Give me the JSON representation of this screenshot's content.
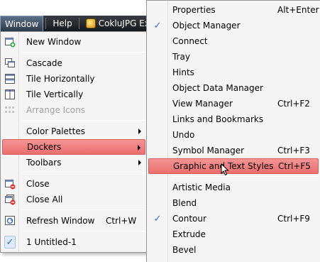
{
  "menubar": {
    "window_label": "Window",
    "help_label": "Help",
    "app_title": "CokluJPG Expo"
  },
  "window_menu": {
    "new_window": "New Window",
    "cascade": "Cascade",
    "tile_horizontally": "Tile Horizontally",
    "tile_vertically": "Tile Vertically",
    "arrange_icons": "Arrange Icons",
    "color_palettes": "Color Palettes",
    "dockers": "Dockers",
    "toolbars": "Toolbars",
    "close": "Close",
    "close_all": "Close All",
    "refresh_window": "Refresh Window",
    "refresh_shortcut": "Ctrl+W",
    "untitled": "1 Untitled-1"
  },
  "dockers_menu": {
    "properties": "Properties",
    "properties_shortcut": "Alt+Enter",
    "object_manager": "Object Manager",
    "connect": "Connect",
    "tray": "Tray",
    "hints": "Hints",
    "object_data_manager": "Object Data Manager",
    "view_manager": "View Manager",
    "view_manager_shortcut": "Ctrl+F2",
    "links_bookmarks": "Links and Bookmarks",
    "undo": "Undo",
    "symbol_manager": "Symbol Manager",
    "symbol_manager_shortcut": "Ctrl+F3",
    "graphic_text_styles": "Graphic and Text Styles",
    "graphic_text_styles_shortcut": "Ctrl+F5",
    "artistic_media": "Artistic Media",
    "blend": "Blend",
    "contour": "Contour",
    "contour_shortcut": "Ctrl+F9",
    "extrude": "Extrude",
    "bevel": "Bevel"
  },
  "colors": {
    "highlight": "#ec6e6e",
    "menubar": "#16181c",
    "check": "#3070c0"
  }
}
